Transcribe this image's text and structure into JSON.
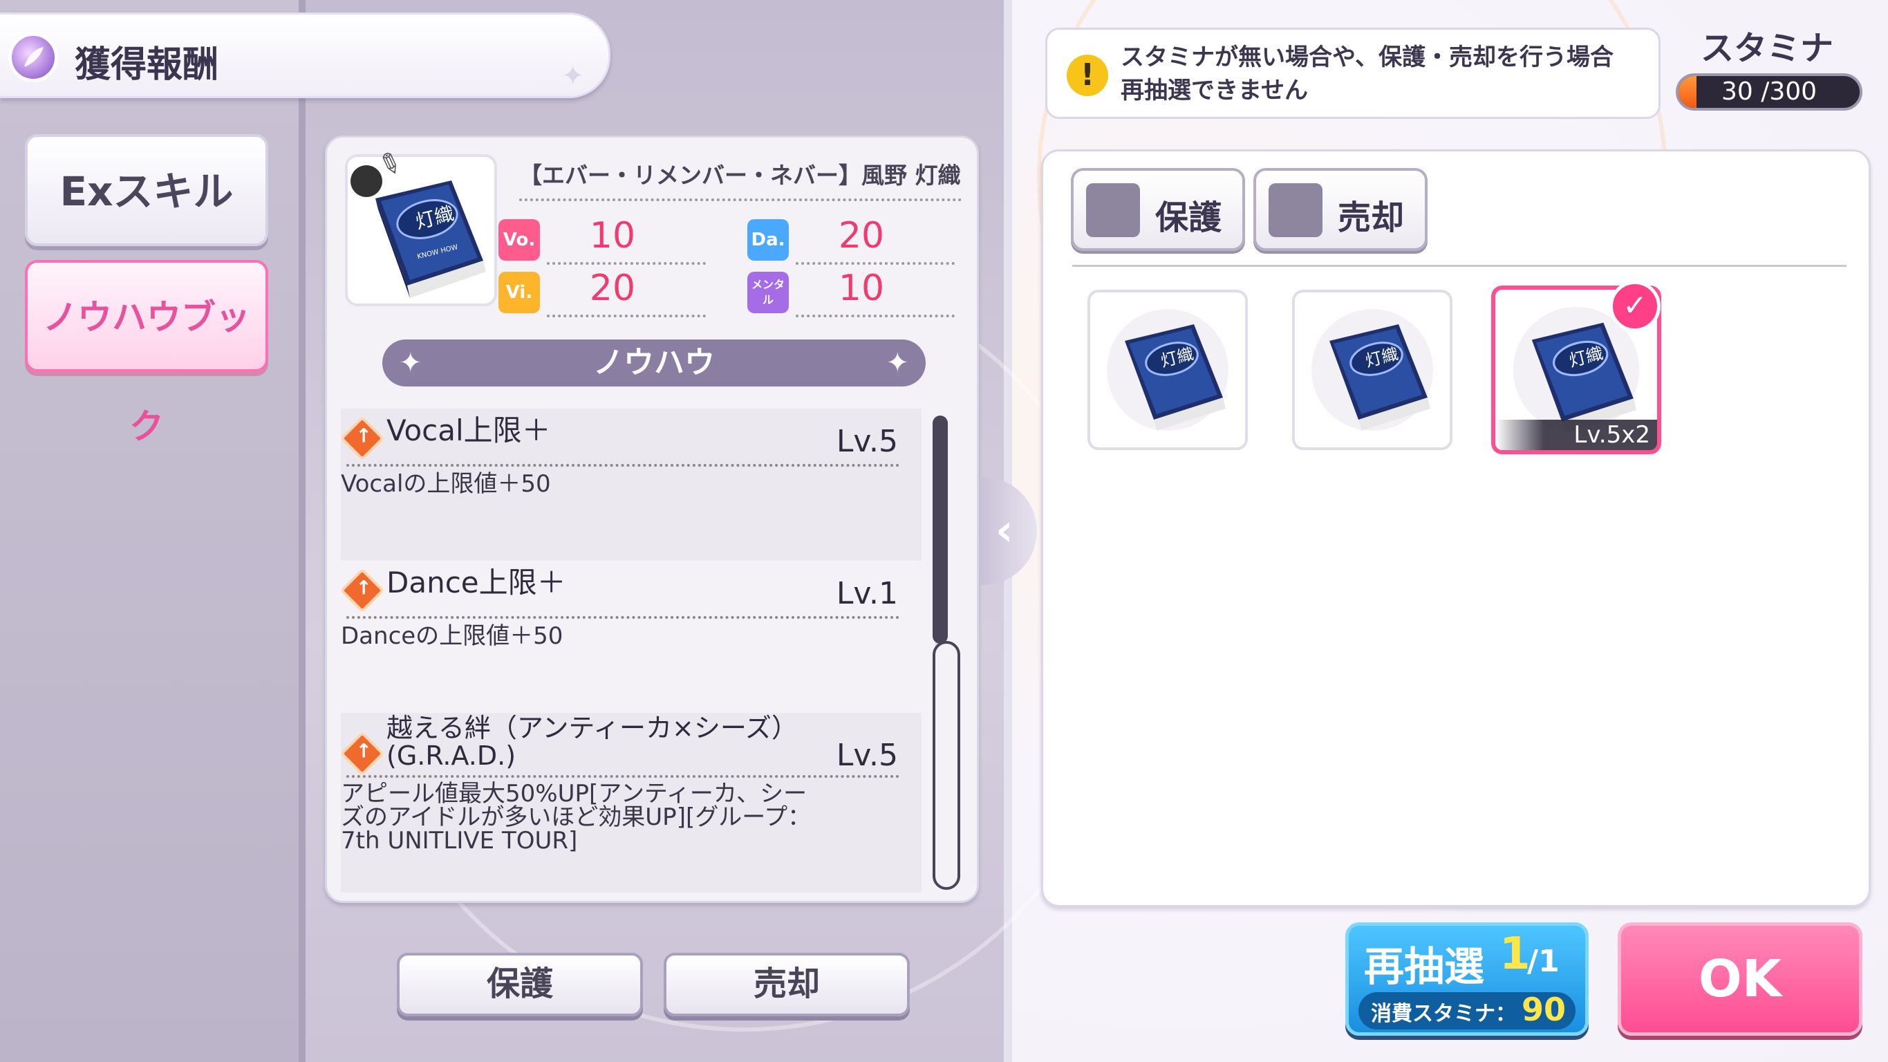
{
  "header": {
    "title": "獲得報酬"
  },
  "tabs": [
    {
      "label": "Exスキル"
    },
    {
      "label": "ノウハウブック"
    }
  ],
  "item": {
    "name": "【エバー・リメンバー・ネバー】風野 灯織",
    "book_title": "灯織",
    "book_subtitle": "KNOW HOW",
    "stats": [
      {
        "badge": "Vo.",
        "value": "10",
        "color": "#ff5c8e"
      },
      {
        "badge": "Da.",
        "value": "20",
        "color": "#4aa8ff"
      },
      {
        "badge": "Vi.",
        "value": "20",
        "color": "#ffb52b"
      },
      {
        "badge": "メンタル",
        "value": "10",
        "color": "#a66be6"
      }
    ]
  },
  "knowhow": {
    "title": "ノウハウ",
    "skills": [
      {
        "name": "Vocal上限＋",
        "level": "Lv.5",
        "desc": "Vocalの上限値＋50"
      },
      {
        "name": "Dance上限＋",
        "level": "Lv.1",
        "desc": "Danceの上限値＋50"
      },
      {
        "name": "越える絆（アンティーカ×シーズ）(G.R.A.D.)",
        "level": "Lv.5",
        "desc_lines": [
          "アピール値最大50%UP[アンティーカ、シー",
          "ズのアイドルが多いほど効果UP][グループ：",
          "7th UNITLIVE TOUR]"
        ]
      }
    ]
  },
  "actions": {
    "protect": "保護",
    "sell": "売却"
  },
  "warning": {
    "lines": [
      "スタミナが無い場合や、保護・売却を行う場合",
      "再抽選できません"
    ]
  },
  "stamina": {
    "label": "スタミナ",
    "current": "30",
    "max": "/300",
    "fraction": 0.1
  },
  "filters": {
    "protect": "保護",
    "sell": "売却"
  },
  "inventory": [
    {
      "title": "灯織",
      "level": "",
      "selected": false
    },
    {
      "title": "灯織",
      "level": "",
      "selected": false
    },
    {
      "title": "灯織",
      "level": "Lv.5x2",
      "selected": true
    }
  ],
  "redraw": {
    "label": "再抽選",
    "count": "1",
    "total": "/1",
    "cost_label": "消費スタミナ：",
    "cost": "90"
  },
  "ok": {
    "label": "OK"
  },
  "icons": {
    "header": "feather-badge-icon",
    "warning": "exclamation-icon",
    "collapse": "chevron-left-icon",
    "check": "check-icon"
  }
}
